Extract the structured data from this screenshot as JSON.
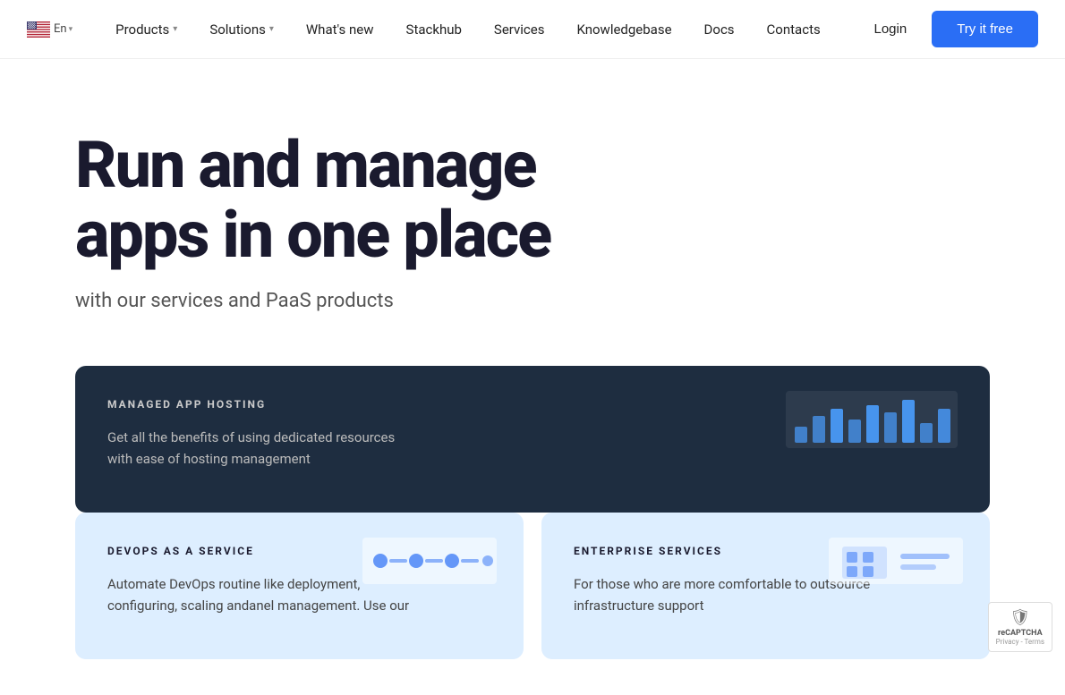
{
  "nav": {
    "lang": "En",
    "items": [
      {
        "label": "Products",
        "has_dropdown": true
      },
      {
        "label": "Solutions",
        "has_dropdown": true
      },
      {
        "label": "What's new",
        "has_dropdown": false
      },
      {
        "label": "Stackhub",
        "has_dropdown": false
      },
      {
        "label": "Services",
        "has_dropdown": false
      },
      {
        "label": "Knowledgebase",
        "has_dropdown": false
      },
      {
        "label": "Docs",
        "has_dropdown": false
      },
      {
        "label": "Contacts",
        "has_dropdown": false
      }
    ],
    "login_label": "Login",
    "try_label": "Try it free"
  },
  "hero": {
    "title_line1": "Run and manage",
    "title_line2": "apps in one place",
    "subtitle": "with our services and PaaS products"
  },
  "cards": [
    {
      "id": "managed-app-hosting",
      "tag": "MANAGED APP HOSTING",
      "description": "Get all the benefits of using dedicated resources with ease of hosting management",
      "style": "dark"
    },
    {
      "id": "devops-as-a-service",
      "tag": "DEVOPS AS A SERVICE",
      "description": "Automate DevOps routine like deployment, configuring, scaling andanel management. Use our",
      "style": "light"
    },
    {
      "id": "enterprise-services",
      "tag": "ENTERPRISE SERVICES",
      "description": "For those who are more comfortable to outsource infrastructure support",
      "style": "light"
    }
  ],
  "recaptcha": {
    "label": "reCAPTCHA",
    "subtext": "Privacy - Terms"
  }
}
